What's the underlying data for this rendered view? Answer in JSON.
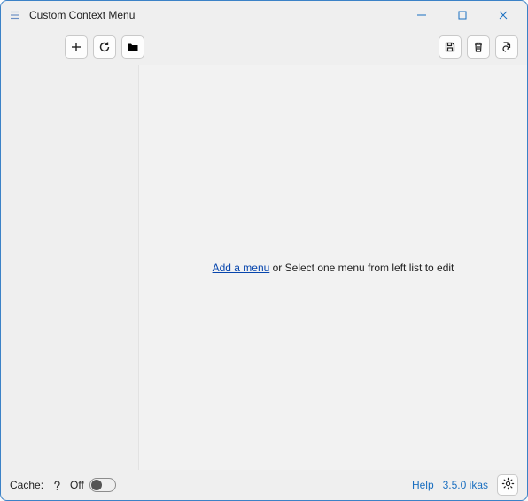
{
  "titlebar": {
    "title": "Custom Context Menu"
  },
  "toolbar": {
    "add_tooltip": "Add",
    "refresh_tooltip": "Refresh",
    "open_tooltip": "Open folder",
    "save_tooltip": "Save",
    "delete_tooltip": "Delete",
    "rename_tooltip": "Rename"
  },
  "content": {
    "add_link": "Add a menu",
    "hint_suffix": " or Select one menu from left list to edit"
  },
  "statusbar": {
    "cache_label": "Cache:",
    "cache_state": "Off",
    "help_label": "Help",
    "version": "3.5.0 ikas"
  }
}
